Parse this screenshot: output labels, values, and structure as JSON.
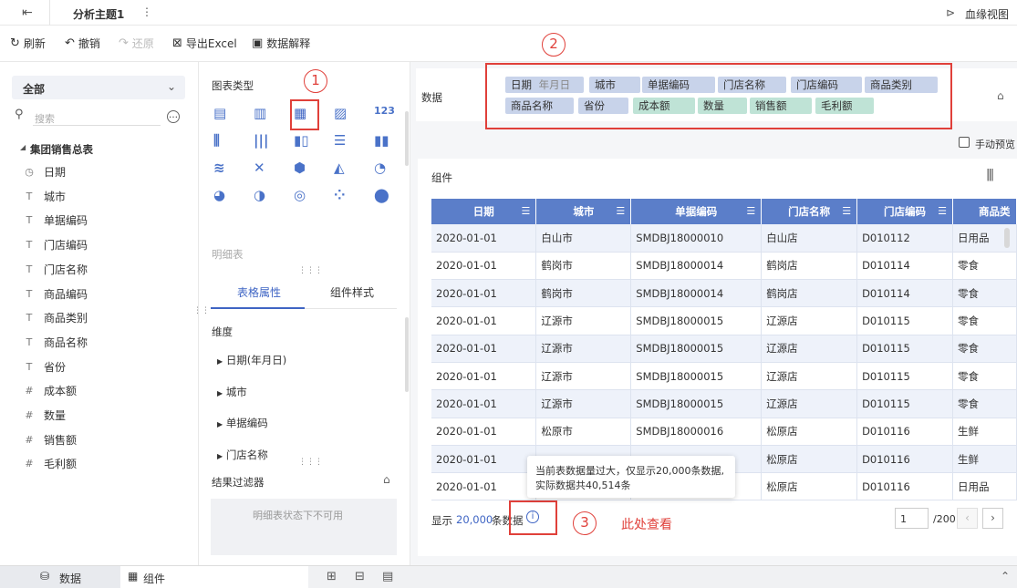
{
  "topbar": {
    "title": "分析主题1",
    "more": "⋮",
    "lineage": "血缘视图"
  },
  "toolbar": {
    "refresh": "刷新",
    "undo": "撤销",
    "redo": "还原",
    "export": "导出Excel",
    "explain": "数据解释"
  },
  "left": {
    "select_value": "全部",
    "search_placeholder": "搜索",
    "group": "集团销售总表",
    "fields": [
      {
        "icon": "◷",
        "label": "日期"
      },
      {
        "icon": "T",
        "label": "城市"
      },
      {
        "icon": "T",
        "label": "单据编码"
      },
      {
        "icon": "T",
        "label": "门店编码"
      },
      {
        "icon": "T",
        "label": "门店名称"
      },
      {
        "icon": "T",
        "label": "商品编码"
      },
      {
        "icon": "T",
        "label": "商品类别"
      },
      {
        "icon": "T",
        "label": "商品名称"
      },
      {
        "icon": "T",
        "label": "省份"
      },
      {
        "icon": "#",
        "label": "成本额"
      },
      {
        "icon": "#",
        "label": "数量"
      },
      {
        "icon": "#",
        "label": "销售额"
      },
      {
        "icon": "#",
        "label": "毛利额"
      }
    ]
  },
  "middle": {
    "chart_type_title": "图表类型",
    "detail_label": "明细表",
    "tab_props": "表格属性",
    "tab_style": "组件样式",
    "dimension": "维度",
    "dims": [
      "日期(年月日)",
      "城市",
      "单据编码",
      "门店名称"
    ],
    "filter_title": "结果过滤器",
    "filter_note": "明细表状态下不可用"
  },
  "data_area": {
    "label": "数据",
    "pills_dim": [
      "日期",
      "城市",
      "单据编码",
      "门店名称",
      "门店编码",
      "商品类别",
      "商品名称",
      "省份"
    ],
    "date_sub": "年月日",
    "pills_measure": [
      "成本额",
      "数量",
      "销售额",
      "毛利额"
    ],
    "manual_preview": "手动预览"
  },
  "component": {
    "title": "组件",
    "columns": [
      "日期",
      "城市",
      "单据编码",
      "门店名称",
      "门店编码",
      "商品类"
    ],
    "rows": [
      [
        "2020-01-01",
        "白山市",
        "SMDBJ18000010",
        "白山店",
        "D010112",
        "日用品"
      ],
      [
        "2020-01-01",
        "鹤岗市",
        "SMDBJ18000014",
        "鹤岗店",
        "D010114",
        "零食"
      ],
      [
        "2020-01-01",
        "鹤岗市",
        "SMDBJ18000014",
        "鹤岗店",
        "D010114",
        "零食"
      ],
      [
        "2020-01-01",
        "辽源市",
        "SMDBJ18000015",
        "辽源店",
        "D010115",
        "零食"
      ],
      [
        "2020-01-01",
        "辽源市",
        "SMDBJ18000015",
        "辽源店",
        "D010115",
        "零食"
      ],
      [
        "2020-01-01",
        "辽源市",
        "SMDBJ18000015",
        "辽源店",
        "D010115",
        "零食"
      ],
      [
        "2020-01-01",
        "辽源市",
        "SMDBJ18000015",
        "辽源店",
        "D010115",
        "零食"
      ],
      [
        "2020-01-01",
        "松原市",
        "SMDBJ18000016",
        "松原店",
        "D010116",
        "生鲜"
      ],
      [
        "2020-01-01",
        "",
        "",
        "松原店",
        "D010116",
        "生鲜"
      ],
      [
        "2020-01-01",
        "",
        "",
        "松原店",
        "D010116",
        "日用品"
      ]
    ],
    "footer_prefix": "显示",
    "footer_count": "20,000",
    "footer_suffix": "条数据",
    "page_value": "1",
    "page_total": "/200",
    "tooltip_line1": "当前表数据量过大，仅显示20,000条数据,",
    "tooltip_line2": "实际数据共40,514条"
  },
  "annotations": {
    "n1": "1",
    "n2": "2",
    "n3": "3",
    "note": "此处查看"
  },
  "bottom": {
    "data_tab": "数据",
    "component_tab": "组件"
  }
}
